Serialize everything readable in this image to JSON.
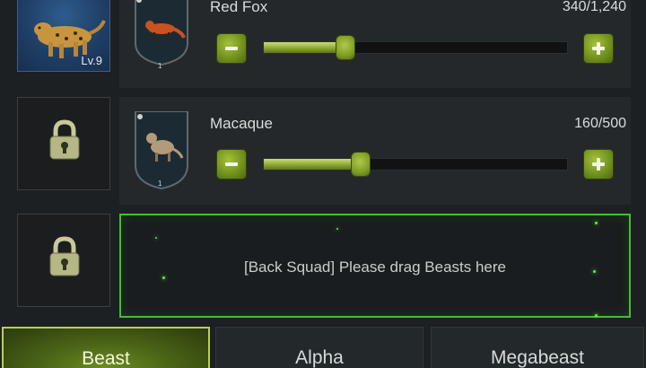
{
  "squad": {
    "rows": [
      {
        "name": "Red Fox",
        "count": "340/1,240",
        "progress": 0.27,
        "slot_level": "Lv.9",
        "shield_badge": "1"
      },
      {
        "name": "Macaque",
        "count": "160/500",
        "progress": 0.32,
        "slot_locked": true,
        "shield_badge": "1"
      }
    ],
    "back_squad_text": "[Back Squad] Please drag Beasts here"
  },
  "tabs": [
    {
      "label": "Beast",
      "active": true
    },
    {
      "label": "Alpha",
      "active": false
    },
    {
      "label": "Megabeast",
      "active": false
    }
  ],
  "colors": {
    "accent_green": "#3ec22a",
    "button_green": "#7b9a22",
    "avatar_blue": "#2f5c8e"
  },
  "icons": {
    "minus": "minus-icon",
    "plus": "plus-icon",
    "lock": "padlock-icon",
    "leopard": "leopard-portrait",
    "fox": "red-fox-icon",
    "macaque": "macaque-icon"
  }
}
